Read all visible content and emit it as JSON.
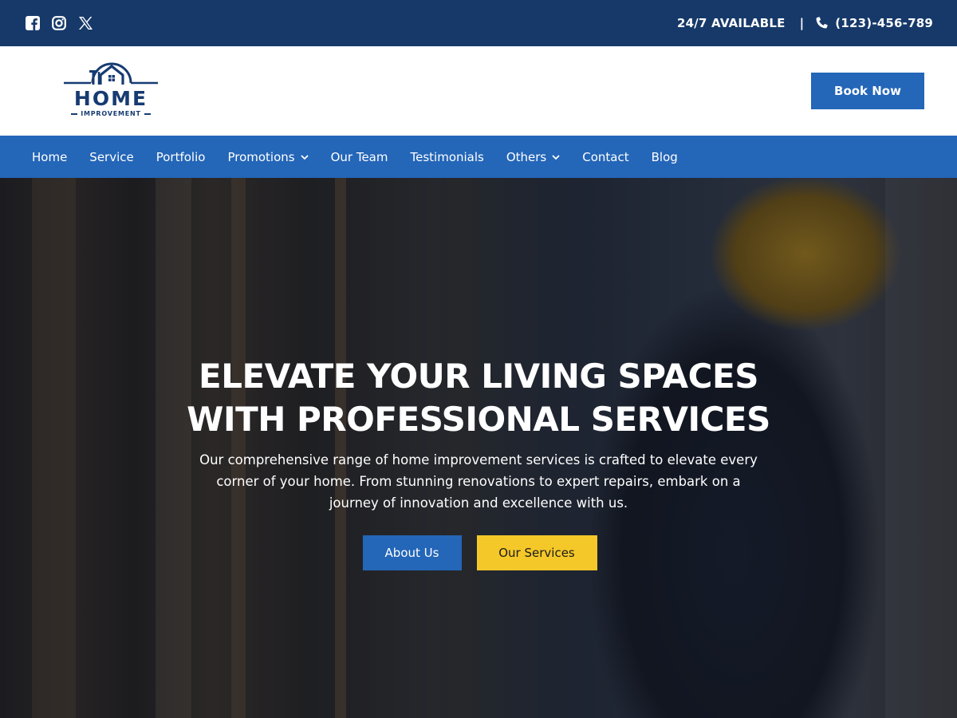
{
  "colors": {
    "topbar": "#163969",
    "nav": "#2466b8",
    "primary_button": "#2466b8",
    "accent_button": "#f5c829",
    "logo": "#173b72"
  },
  "topbar": {
    "social_icons": [
      "facebook-icon",
      "instagram-icon",
      "x-icon"
    ],
    "availability": "24/7 AVAILABLE",
    "separator": "|",
    "phone": "(123)-456-789"
  },
  "header": {
    "logo_title": "HOME",
    "logo_subtitle": "IMPROVEMENT",
    "book_button": "Book Now"
  },
  "nav": {
    "items": [
      {
        "label": "Home",
        "dropdown": false
      },
      {
        "label": "Service",
        "dropdown": false
      },
      {
        "label": "Portfolio",
        "dropdown": false
      },
      {
        "label": "Promotions",
        "dropdown": true
      },
      {
        "label": "Our Team",
        "dropdown": false
      },
      {
        "label": "Testimonials",
        "dropdown": false
      },
      {
        "label": "Others",
        "dropdown": true
      },
      {
        "label": "Contact",
        "dropdown": false
      },
      {
        "label": "Blog",
        "dropdown": false
      }
    ]
  },
  "hero": {
    "title_line1": "ELEVATE YOUR LIVING SPACES",
    "title_line2": "WITH PROFESSIONAL SERVICES",
    "description": "Our comprehensive range of home improvement services is crafted to elevate every corner of your home. From stunning renovations to expert repairs, embark on a journey of innovation and excellence with us.",
    "button_primary": "About Us",
    "button_secondary": "Our Services"
  }
}
